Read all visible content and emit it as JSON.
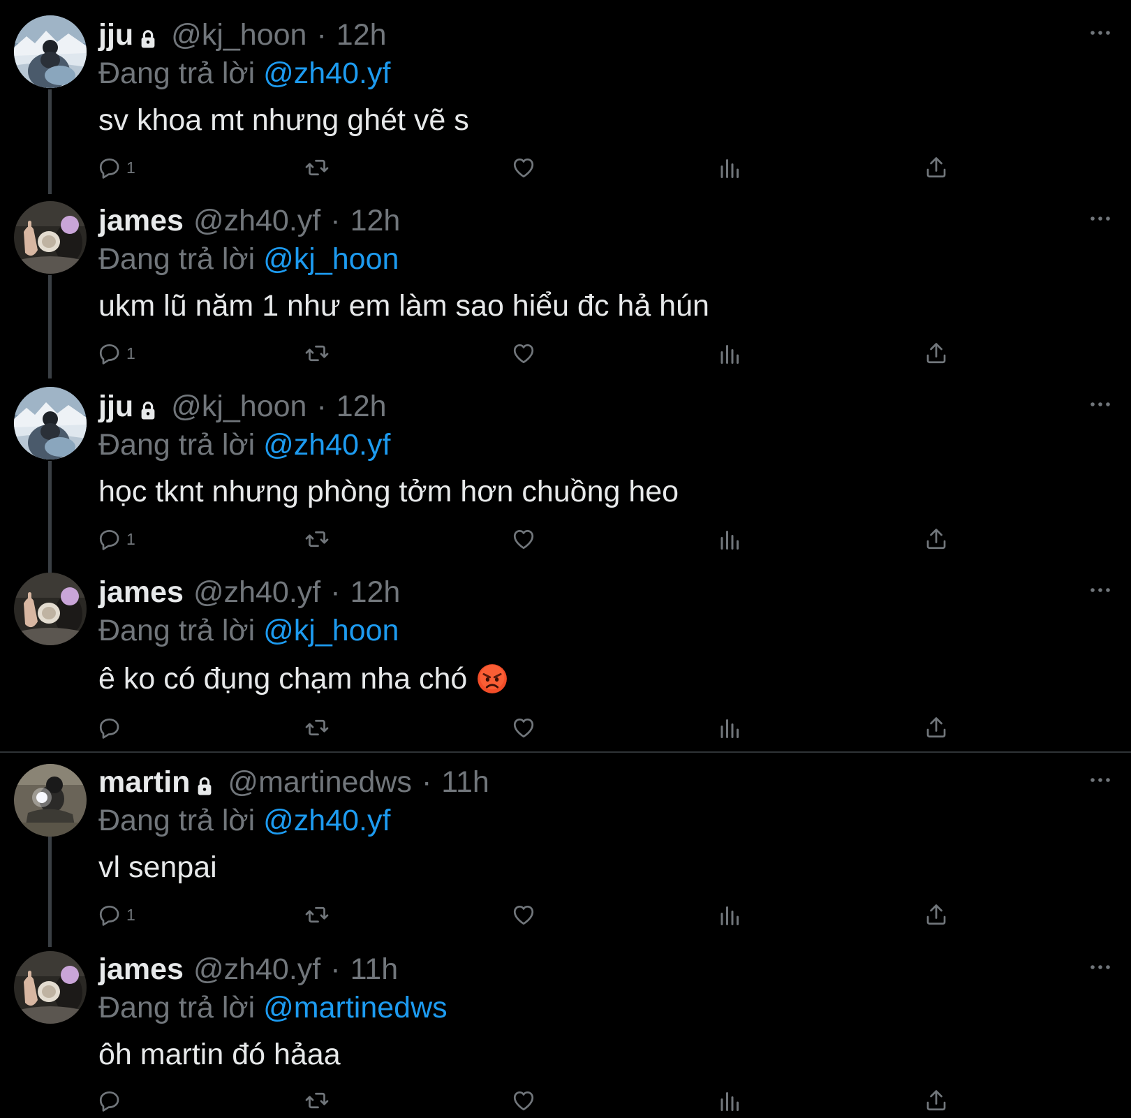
{
  "colors": {
    "background": "#000000",
    "primary_text": "#e7e9ea",
    "secondary_text": "#71767b",
    "mention": "#1d9bf0",
    "thread_line": "#3a3f44"
  },
  "reply_prefix": "Đang trả lời",
  "tweets": [
    {
      "name": "jju",
      "locked": true,
      "handle": "@kj_hoon",
      "separator": "·",
      "time": "12h",
      "replying_to": "@zh40.yf",
      "text": "sv khoa mt nhưng ghét vẽ s",
      "reply_count": "1",
      "avatar_icon": "avatar-snow-mountain"
    },
    {
      "name": "james",
      "locked": false,
      "handle": "@zh40.yf",
      "separator": "·",
      "time": "12h",
      "replying_to": "@kj_hoon",
      "text": "ukm lũ năm 1 như em làm sao hiểu đc hả hún",
      "reply_count": "1",
      "avatar_icon": "avatar-hand-portrait"
    },
    {
      "name": "jju",
      "locked": true,
      "handle": "@kj_hoon",
      "separator": "·",
      "time": "12h",
      "replying_to": "@zh40.yf",
      "text": "học tknt nhưng phòng tởm hơn chuồng heo",
      "reply_count": "1",
      "avatar_icon": "avatar-snow-mountain"
    },
    {
      "name": "james",
      "locked": false,
      "handle": "@zh40.yf",
      "separator": "·",
      "time": "12h",
      "replying_to": "@kj_hoon",
      "text": "ê ko có đụng chạm nha chó",
      "emoji": "angry-face-icon",
      "reply_count": "",
      "avatar_icon": "avatar-hand-portrait"
    },
    {
      "name": "martin",
      "locked": true,
      "handle": "@martinedws",
      "separator": "·",
      "time": "11h",
      "replying_to": "@zh40.yf",
      "text": "vl senpai",
      "reply_count": "1",
      "avatar_icon": "avatar-mirror-selfie"
    },
    {
      "name": "james",
      "locked": false,
      "handle": "@zh40.yf",
      "separator": "·",
      "time": "11h",
      "replying_to": "@martinedws",
      "text": "ôh martin đó hảaa",
      "reply_count": "",
      "avatar_icon": "avatar-hand-portrait"
    }
  ]
}
